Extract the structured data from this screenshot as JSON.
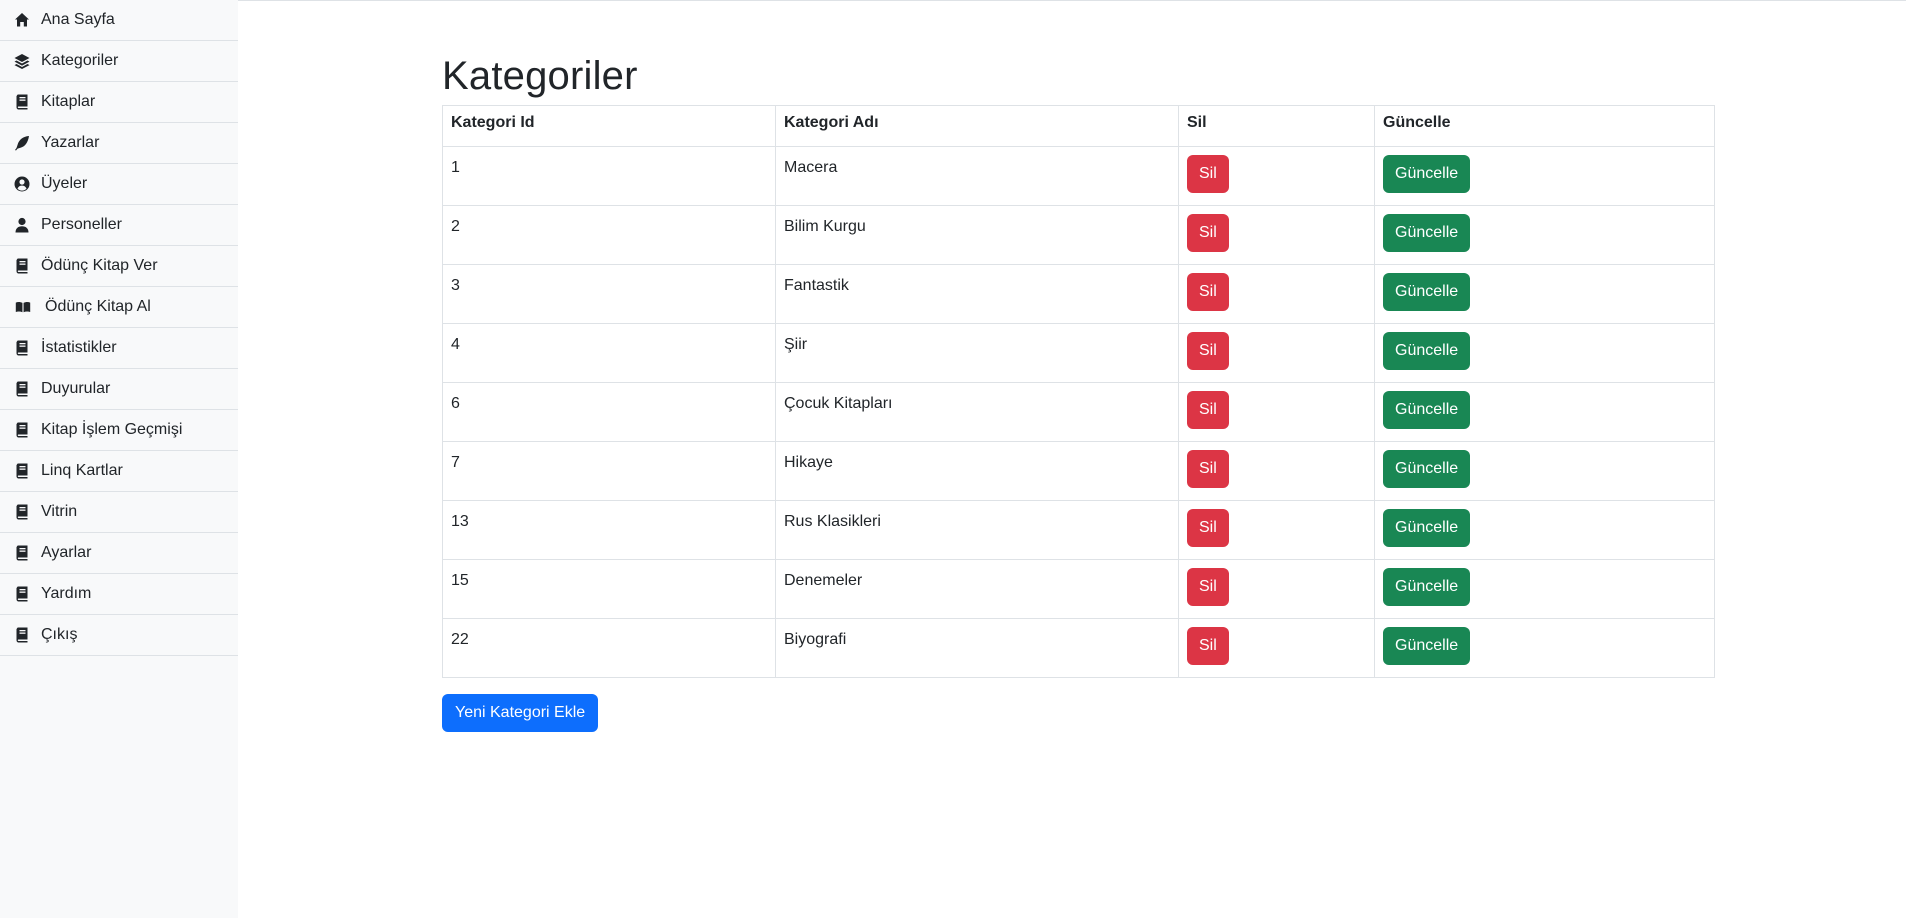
{
  "sidebar": {
    "items": [
      {
        "label": "Ana Sayfa",
        "icon": "home-icon"
      },
      {
        "label": "Kategoriler",
        "icon": "layers-icon"
      },
      {
        "label": "Kitaplar",
        "icon": "book-icon"
      },
      {
        "label": "Yazarlar",
        "icon": "feather-icon"
      },
      {
        "label": "Üyeler",
        "icon": "user-circle-icon"
      },
      {
        "label": "Personeller",
        "icon": "user-icon"
      },
      {
        "label": "Ödünç Kitap Ver",
        "icon": "book-icon"
      },
      {
        "label": "Ödünç Kitap Al",
        "icon": "open-book-icon"
      },
      {
        "label": "İstatistikler",
        "icon": "book-icon"
      },
      {
        "label": "Duyurular",
        "icon": "book-icon"
      },
      {
        "label": "Kitap İşlem Geçmişi",
        "icon": "book-icon"
      },
      {
        "label": "Linq Kartlar",
        "icon": "book-icon"
      },
      {
        "label": "Vitrin",
        "icon": "book-icon"
      },
      {
        "label": "Ayarlar",
        "icon": "book-icon"
      },
      {
        "label": "Yardım",
        "icon": "book-icon"
      },
      {
        "label": "Çıkış",
        "icon": "book-icon"
      }
    ]
  },
  "main": {
    "title": "Kategoriler",
    "table": {
      "headers": [
        "Kategori Id",
        "Kategori Adı",
        "Sil",
        "Güncelle"
      ],
      "rows": [
        {
          "id": "1",
          "name": "Macera"
        },
        {
          "id": "2",
          "name": "Bilim Kurgu"
        },
        {
          "id": "3",
          "name": "Fantastik"
        },
        {
          "id": "4",
          "name": "Şiir"
        },
        {
          "id": "6",
          "name": "Çocuk Kitapları"
        },
        {
          "id": "7",
          "name": "Hikaye"
        },
        {
          "id": "13",
          "name": "Rus Klasikleri"
        },
        {
          "id": "15",
          "name": "Denemeler"
        },
        {
          "id": "22",
          "name": "Biyografi"
        }
      ],
      "delete_label": "Sil",
      "update_label": "Güncelle"
    },
    "add_button_label": "Yeni Kategori Ekle"
  },
  "colors": {
    "danger": "#dc3545",
    "success": "#198754",
    "primary": "#0d6efd",
    "sidebar_bg": "#f8f9fa"
  }
}
